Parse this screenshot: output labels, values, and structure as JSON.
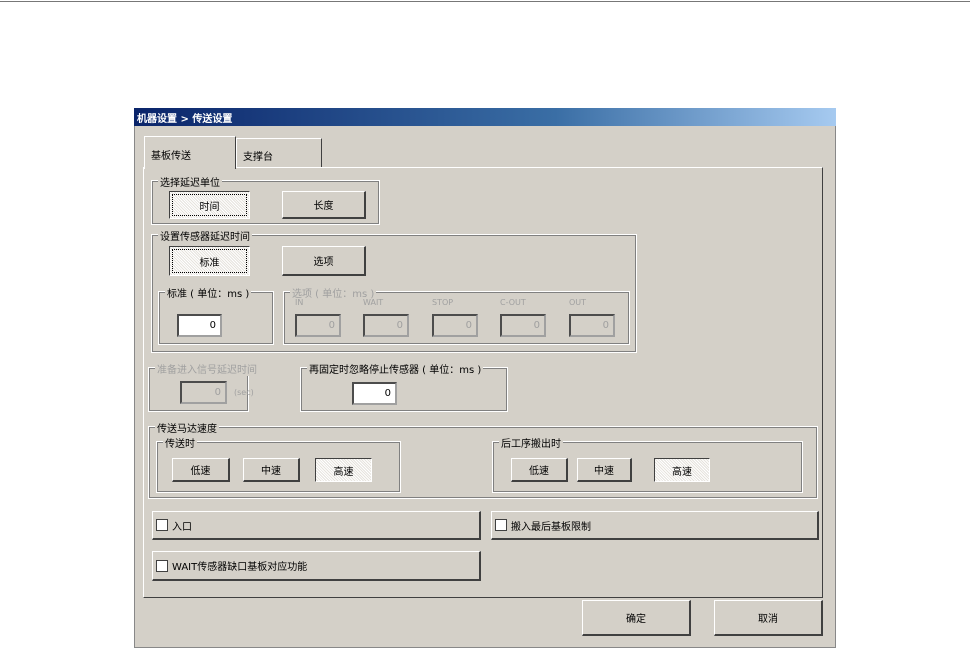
{
  "title": "机器设置 > 传送设置",
  "tabs": [
    "基板传送",
    "支撑台"
  ],
  "delay_unit": {
    "label": "选择延迟单位",
    "buttons": [
      "时间",
      "长度"
    ]
  },
  "sensor_delay": {
    "label": "设置传感器延迟时间",
    "buttons": [
      "标准",
      "选项"
    ],
    "standard": {
      "label": "标准 ( 单位：ms )",
      "value": "0"
    },
    "options": {
      "label": "选项 ( 单位：ms )",
      "fields": [
        {
          "label": "IN",
          "value": "0"
        },
        {
          "label": "WAIT",
          "value": "0"
        },
        {
          "label": "STOP",
          "value": "0"
        },
        {
          "label": "C-OUT",
          "value": "0"
        },
        {
          "label": "OUT",
          "value": "0"
        }
      ]
    }
  },
  "ready_signal": {
    "label": "准备进入信号延迟时间",
    "value": "0",
    "unit": "(sec)"
  },
  "refix": {
    "label": "再固定时忽略停止传感器 ( 单位：ms )",
    "value": "0"
  },
  "motor_speed": {
    "label": "传送马达速度",
    "transfer": {
      "label": "传送时",
      "buttons": [
        "低速",
        "中速",
        "高速"
      ]
    },
    "unload": {
      "label": "后工序搬出时",
      "buttons": [
        "低速",
        "中速",
        "高速"
      ]
    }
  },
  "checkboxes": [
    "入口",
    "搬入最后基板限制",
    "WAIT传感器缺口基板对应功能"
  ],
  "ok": "确定",
  "cancel": "取消"
}
